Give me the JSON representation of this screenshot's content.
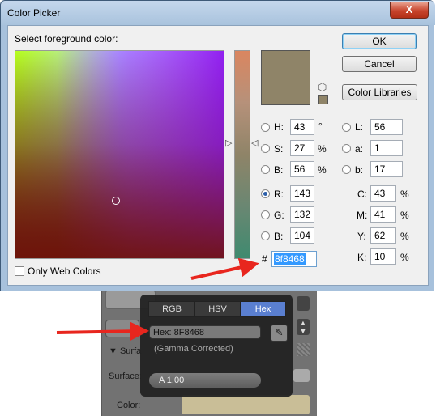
{
  "dialog": {
    "title": "Color Picker",
    "close_glyph": "X",
    "select_label": "Select foreground color:",
    "ok_label": "OK",
    "cancel_label": "Cancel",
    "libraries_label": "Color Libraries",
    "web_colors_label": "Only Web Colors",
    "current_color": "#8f8468",
    "hex_symbol": "#",
    "hex_value": "8f8468",
    "hsb": [
      {
        "label": "H:",
        "value": "43",
        "unit": "°",
        "checked": false
      },
      {
        "label": "S:",
        "value": "27",
        "unit": "%",
        "checked": false
      },
      {
        "label": "B:",
        "value": "56",
        "unit": "%",
        "checked": false
      }
    ],
    "rgb": [
      {
        "label": "R:",
        "value": "143",
        "checked": true
      },
      {
        "label": "G:",
        "value": "132",
        "checked": false
      },
      {
        "label": "B:",
        "value": "104",
        "checked": false
      }
    ],
    "lab": [
      {
        "label": "L:",
        "value": "56"
      },
      {
        "label": "a:",
        "value": "1"
      },
      {
        "label": "b:",
        "value": "17"
      }
    ],
    "cmyk": [
      {
        "label": "C:",
        "value": "43",
        "unit": "%"
      },
      {
        "label": "M:",
        "value": "41",
        "unit": "%"
      },
      {
        "label": "Y:",
        "value": "62",
        "unit": "%"
      },
      {
        "label": "K:",
        "value": "10",
        "unit": "%"
      }
    ]
  },
  "popup": {
    "tabs": [
      "RGB",
      "HSV",
      "Hex"
    ],
    "active_tab": "Hex",
    "hex_field": "Hex: 8F8468",
    "gamma_note": "(Gamma Corrected)",
    "alpha_field": "A 1.00",
    "eyedropper_icon": "eyedropper-icon"
  },
  "background_panel": {
    "surface_header": "Surfa",
    "surface_label": "Surface:",
    "color_label": "Color:",
    "color_swatch": "#c9be97"
  },
  "annotations": {
    "arrow_color": "#e8261e"
  }
}
